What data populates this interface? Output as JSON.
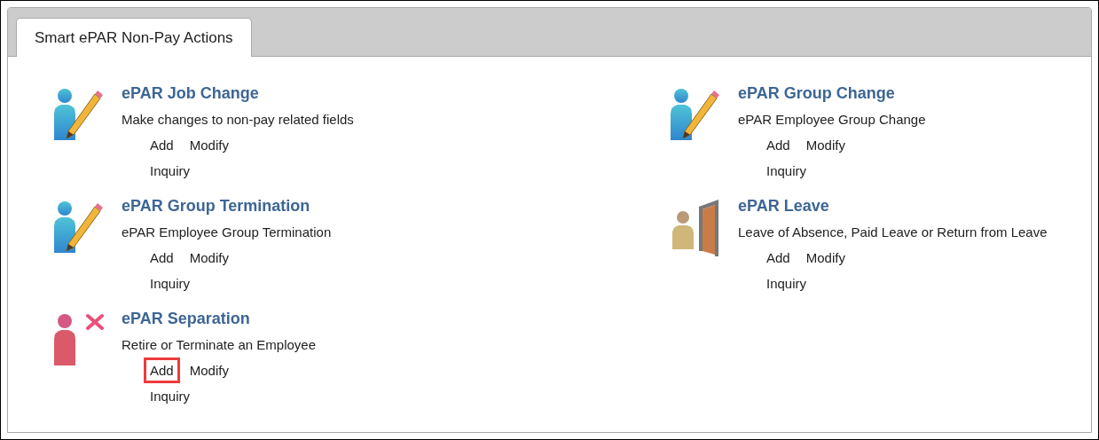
{
  "tabs": [
    {
      "label": "Smart ePAR Non-Pay Actions",
      "selected": true
    }
  ],
  "columns": [
    {
      "items": [
        {
          "kind": "edit",
          "title": "ePAR Job Change",
          "description": "Make changes to non-pay related fields",
          "action_rows": [
            [
              {
                "label": "Add",
                "highlighted": false
              },
              {
                "label": "Modify",
                "highlighted": false
              }
            ],
            [
              {
                "label": "Inquiry",
                "highlighted": false
              }
            ]
          ]
        },
        {
          "kind": "edit",
          "title": "ePAR Group Termination",
          "description": "ePAR Employee Group Termination",
          "action_rows": [
            [
              {
                "label": "Add",
                "highlighted": false
              },
              {
                "label": "Modify",
                "highlighted": false
              }
            ],
            [
              {
                "label": "Inquiry",
                "highlighted": false
              }
            ]
          ]
        },
        {
          "kind": "separation",
          "title": "ePAR Separation",
          "description": "Retire or Terminate an Employee",
          "action_rows": [
            [
              {
                "label": "Add",
                "highlighted": true
              },
              {
                "label": "Modify",
                "highlighted": false
              }
            ],
            [
              {
                "label": "Inquiry",
                "highlighted": false
              }
            ]
          ]
        }
      ]
    },
    {
      "items": [
        {
          "kind": "edit",
          "title": "ePAR Group Change",
          "description": "ePAR Employee Group Change",
          "action_rows": [
            [
              {
                "label": "Add",
                "highlighted": false
              },
              {
                "label": "Modify",
                "highlighted": false
              }
            ],
            [
              {
                "label": "Inquiry",
                "highlighted": false
              }
            ]
          ]
        },
        {
          "kind": "leave",
          "title": "ePAR Leave",
          "description": "Leave of Absence, Paid Leave or Return from Leave",
          "action_rows": [
            [
              {
                "label": "Add",
                "highlighted": false
              },
              {
                "label": "Modify",
                "highlighted": false
              }
            ],
            [
              {
                "label": "Inquiry",
                "highlighted": false
              }
            ]
          ]
        }
      ]
    }
  ]
}
